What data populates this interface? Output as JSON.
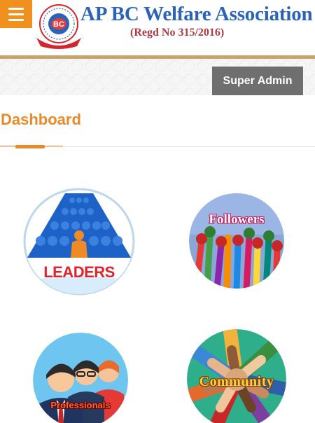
{
  "header": {
    "menu_icon": "hamburger-icon",
    "logo_icon": "bc-emblem-icon",
    "title": "AP BC Welfare Association",
    "subtitle": "(Regd No 315/2016)",
    "title_color": "#2a63b8",
    "subtitle_color": "#b03a43"
  },
  "user": {
    "role": "Super Admin"
  },
  "dashboard": {
    "title": "Dashboard",
    "accent_color": "#e8892a",
    "tiles": [
      {
        "label": "LEADERS",
        "icon": "leaders-crowd-image"
      },
      {
        "label": "Followers",
        "icon": "raised-hands-image"
      },
      {
        "label": "Professionals",
        "icon": "professionals-image"
      },
      {
        "label": "Community",
        "icon": "stacked-hands-image"
      }
    ]
  }
}
